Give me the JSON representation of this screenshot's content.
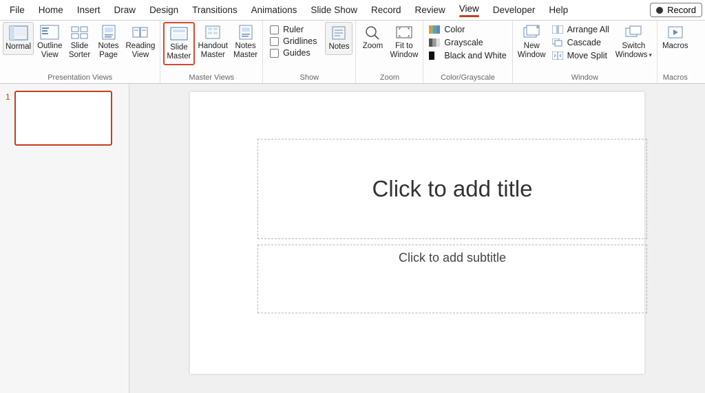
{
  "tabs": {
    "file": "File",
    "home": "Home",
    "insert": "Insert",
    "draw": "Draw",
    "design": "Design",
    "transitions": "Transitions",
    "animations": "Animations",
    "slideshow": "Slide Show",
    "record": "Record",
    "review": "Review",
    "view": "View",
    "developer": "Developer",
    "help": "Help"
  },
  "record_btn": "Record",
  "ribbon": {
    "presentation_views": {
      "label": "Presentation Views",
      "normal": "Normal",
      "outline": "Outline\nView",
      "sorter": "Slide\nSorter",
      "notes_page": "Notes\nPage",
      "reading": "Reading\nView"
    },
    "master_views": {
      "label": "Master Views",
      "slide_master": "Slide\nMaster",
      "handout_master": "Handout\nMaster",
      "notes_master": "Notes\nMaster"
    },
    "show": {
      "label": "Show",
      "ruler": "Ruler",
      "gridlines": "Gridlines",
      "guides": "Guides",
      "notes": "Notes"
    },
    "zoom": {
      "label": "Zoom",
      "zoom": "Zoom",
      "fit": "Fit to\nWindow"
    },
    "color": {
      "label": "Color/Grayscale",
      "color": "Color",
      "gray": "Grayscale",
      "bw": "Black and White"
    },
    "window": {
      "label": "Window",
      "new_window": "New\nWindow",
      "arrange": "Arrange All",
      "cascade": "Cascade",
      "move_split": "Move Split",
      "switch": "Switch\nWindows"
    },
    "macros": {
      "label": "Macros",
      "macros": "Macros"
    }
  },
  "panel": {
    "thumb_number": "1",
    "title_placeholder": "Click to add title",
    "subtitle_placeholder": "Click to add subtitle"
  }
}
